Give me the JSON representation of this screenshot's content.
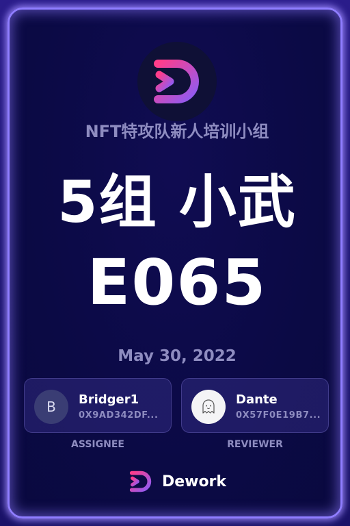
{
  "organization": "NFT特攻队新人培训小组",
  "title": "5组 小武",
  "code": "E065",
  "date": "May 30, 2022",
  "assignee": {
    "avatar_letter": "B",
    "name": "Bridger1",
    "address": "0X9AD342DF...",
    "role": "ASSIGNEE"
  },
  "reviewer": {
    "avatar_icon": "ghost-icon",
    "name": "Dante",
    "address": "0X57F0E19B7...",
    "role": "REVIEWER"
  },
  "brand": {
    "name": "Dework",
    "logo_icon": "dework-logo-icon"
  },
  "colors": {
    "border_glow": "#8f7dff",
    "card_background": "#0b0a45",
    "muted_text": "#8e8cc0",
    "logo_gradient_start": "#ff3d8b",
    "logo_gradient_end": "#8b5cf6"
  }
}
